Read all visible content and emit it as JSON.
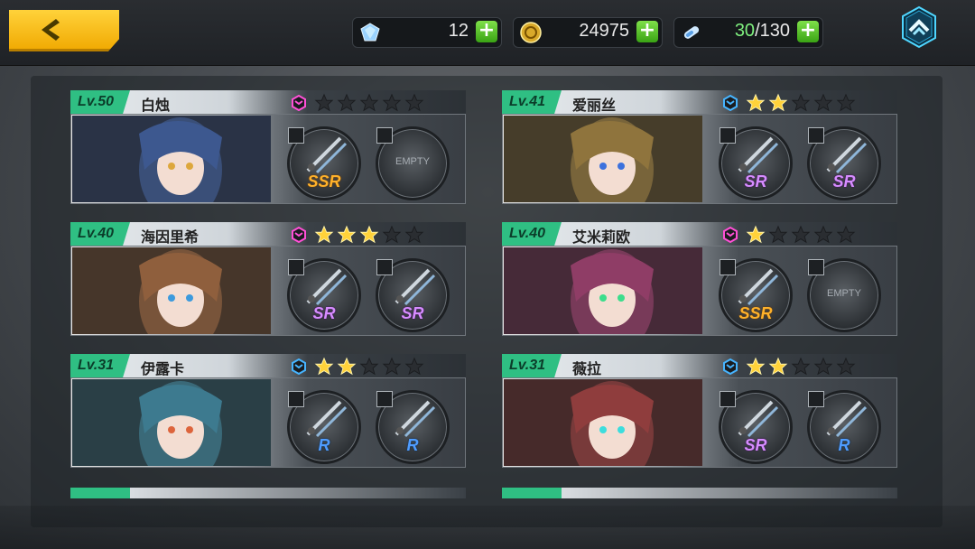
{
  "top": {
    "gems": "12",
    "coins": "24975",
    "stamina_current": "30",
    "stamina_max": "/130"
  },
  "cards": [
    {
      "level": "Lv.50",
      "name": "白烛",
      "badge_color": "#ff4fd6",
      "stars": 0,
      "weapons": [
        {
          "rarity": "SSR",
          "cls": "r-ssr",
          "empty": false
        },
        {
          "rarity": "EMPTY",
          "cls": "",
          "empty": true
        }
      ]
    },
    {
      "level": "Lv.41",
      "name": "爱丽丝",
      "badge_color": "#46b4ff",
      "stars": 2,
      "weapons": [
        {
          "rarity": "SR",
          "cls": "r-sr",
          "empty": false
        },
        {
          "rarity": "SR",
          "cls": "r-sr",
          "empty": false
        }
      ]
    },
    {
      "level": "Lv.40",
      "name": "海因里希",
      "badge_color": "#ff4fd6",
      "stars": 3,
      "weapons": [
        {
          "rarity": "SR",
          "cls": "r-sr",
          "empty": false
        },
        {
          "rarity": "SR",
          "cls": "r-sr",
          "empty": false
        }
      ]
    },
    {
      "level": "Lv.40",
      "name": "艾米莉欧",
      "badge_color": "#ff4fd6",
      "stars": 1,
      "weapons": [
        {
          "rarity": "SSR",
          "cls": "r-ssr",
          "empty": false
        },
        {
          "rarity": "EMPTY",
          "cls": "",
          "empty": true
        }
      ]
    },
    {
      "level": "Lv.31",
      "name": "伊露卡",
      "badge_color": "#46b4ff",
      "stars": 2,
      "weapons": [
        {
          "rarity": "R",
          "cls": "r-r",
          "empty": false
        },
        {
          "rarity": "R",
          "cls": "r-r",
          "empty": false
        }
      ]
    },
    {
      "level": "Lv.31",
      "name": "薇拉",
      "badge_color": "#46b4ff",
      "stars": 2,
      "weapons": [
        {
          "rarity": "SR",
          "cls": "r-sr",
          "empty": false
        },
        {
          "rarity": "R",
          "cls": "r-r",
          "empty": false
        }
      ]
    }
  ]
}
